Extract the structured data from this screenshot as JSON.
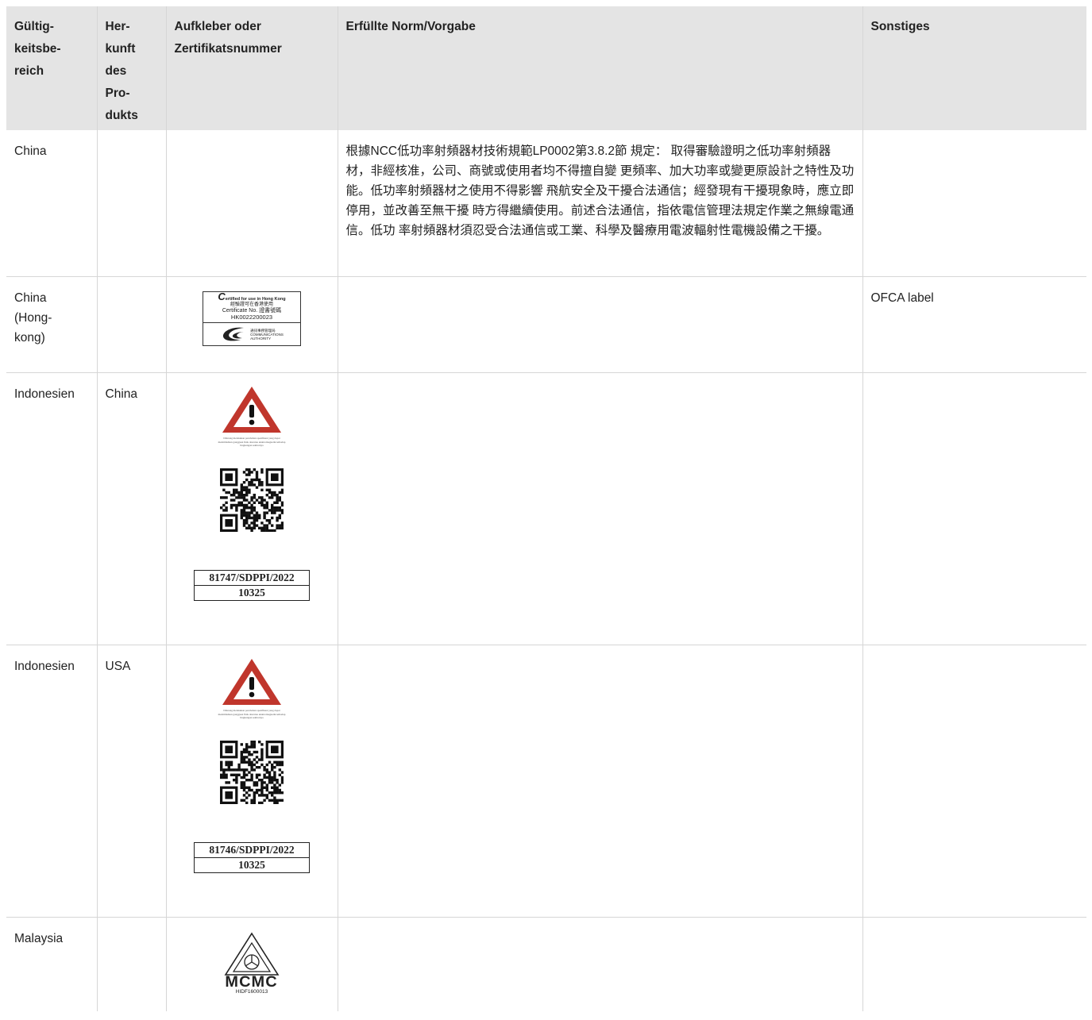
{
  "headers": {
    "region": "Gültig-keitsbe-reich",
    "origin": "Her-kunft des Pro-dukts",
    "label": "Aufkleber oder Zertifikatsnummer",
    "norm": "Erfüllte Norm/Vorgabe",
    "other": "Sonstiges"
  },
  "rows": [
    {
      "region": "China",
      "origin": "",
      "norm": "根據NCC低功率射頻器材技術規範LP0002第3.8.2節 規定： 取得審驗證明之低功率射頻器材，非經核准，公司、商號或使用者均不得擅自變 更頻率、加大功率或變更原設計之特性及功能。低功率射頻器材之使用不得影響 飛航安全及干擾合法通信；經發現有干擾現象時，應立即停用，並改善至無干擾 時方得繼續使用。前述合法通信，指依電信管理法規定作業之無線電通信。低功 率射頻器材須忍受合法通信或工業、科學及醫療用電波輻射性電機設備之干擾。",
      "other": ""
    },
    {
      "region": "China (Hong-kong)",
      "origin": "",
      "norm": "",
      "other": "OFCA label",
      "label": {
        "line1_initial": "C",
        "line1_rest": "ertified for use in Hong Kong",
        "line2": "經驗證可在香港使用",
        "line3": "Certificate No. 證書號碼",
        "line4": "HK0022200023",
        "authority_zh": "通訊事務管理局",
        "authority_en1": "COMMUNICATIONS",
        "authority_en2": "AUTHORITY"
      }
    },
    {
      "region": "Indonesien",
      "origin": "China",
      "norm": "",
      "other": "",
      "label": {
        "warning_text": "Dilarang melakukan perubahan spesifikasi yang dapat menimbulkan gangguan fisik dan/atau elektromagnetik terhadap lingkungan sekitarnya",
        "cert_line1": "81747/SDPPI/2022",
        "cert_line2": "10325"
      }
    },
    {
      "region": "Indonesien",
      "origin": "USA",
      "norm": "",
      "other": "",
      "label": {
        "warning_text": "Dilarang melakukan perubahan spesifikasi yang dapat menimbulkan gangguan fisik dan/atau elektromagnetik terhadap lingkungan sekitarnya",
        "cert_line1": "81746/SDPPI/2022",
        "cert_line2": "10325"
      }
    },
    {
      "region": "Malaysia",
      "origin": "",
      "norm": "",
      "other": "",
      "label": {
        "mark": "MCMC",
        "id": "HIDF1600013"
      }
    }
  ]
}
